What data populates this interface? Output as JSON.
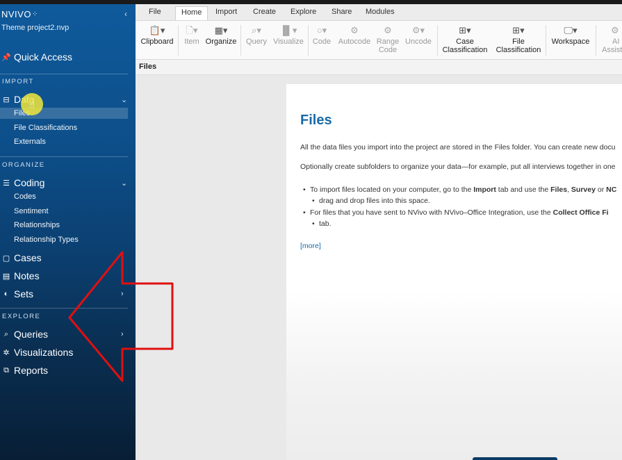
{
  "app": {
    "brand": "NVIVO",
    "project": "Theme project2.nvp"
  },
  "sidebar": {
    "quick_access": "Quick Access",
    "sections": {
      "import": "IMPORT",
      "organize": "ORGANIZE",
      "explore": "EXPLORE"
    },
    "data": {
      "label": "Data",
      "items": [
        "Files",
        "File Classifications",
        "Externals"
      ]
    },
    "coding": {
      "label": "Coding",
      "items": [
        "Codes",
        "Sentiment",
        "Relationships",
        "Relationship Types"
      ]
    },
    "cases": "Cases",
    "notes": "Notes",
    "sets": "Sets",
    "queries": "Queries",
    "visualizations": "Visualizations",
    "reports": "Reports"
  },
  "ribbon": {
    "tabs": [
      "File",
      "Home",
      "Import",
      "Create",
      "Explore",
      "Share",
      "Modules"
    ],
    "active_tab": "Home",
    "buttons": {
      "clipboard": "Clipboard",
      "item": "Item",
      "organize": "Organize",
      "query": "Query",
      "visualize": "Visualize",
      "code": "Code",
      "autocode": "Autocode",
      "range_code_1": "Range",
      "range_code_2": "Code",
      "uncode": "Uncode",
      "case_class_1": "Case",
      "case_class_2": "Classification",
      "file_class_1": "File",
      "file_class_2": "Classification",
      "workspace": "Workspace",
      "ai_1": "AI",
      "ai_2": "Assist"
    }
  },
  "breadcrumb": "Files",
  "document": {
    "title": "Files",
    "p1": "All the data files you import into the project are stored in the Files folder. You can create new docu",
    "p2": "Optionally create subfolders to organize your data—for example, put all interviews together in one",
    "b1_l1_a": "To import files located on your computer, go to the ",
    "b1_l1_b": "Import",
    "b1_l1_c": " tab and use the ",
    "b1_l1_d": "Files",
    "b1_l1_e": ", ",
    "b1_l1_f": "Survey",
    "b1_l1_g": " or ",
    "b1_l1_h": "NC",
    "b1_l2": "drag and drop files into this space.",
    "b2_l1_a": "For files that you have sent to NVivo with NVivo–Office Integration, use the ",
    "b2_l1_b": "Collect Office Fi",
    "b2_l2": "tab.",
    "more": "[more]"
  },
  "colors": {
    "sidebar_top": "#0f5a9c",
    "sidebar_bottom": "#081e35",
    "title_blue": "#1a6aa8",
    "arrow_red": "#e01010"
  }
}
